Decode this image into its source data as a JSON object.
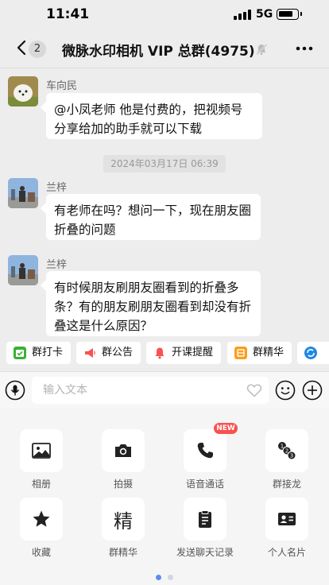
{
  "status_bar": {
    "time": "11:41",
    "network": "5G",
    "battery_level": 0.78
  },
  "nav": {
    "back_badge": "2",
    "title": "微脉水印相机 VIP 总群(4975)"
  },
  "messages": [
    {
      "sender": "车向民",
      "text": "@小凤老师  他是付费的，把视频号分享给加的助手就可以下载"
    },
    {
      "sender": "兰梓",
      "text": "有老师在吗？想问一下，现在朋友圈折叠的问题"
    },
    {
      "sender": "兰梓",
      "text": "有时候朋友刷朋友圈看到的折叠多条？有的朋友刷朋友圈看到却没有折叠这是什么原因？"
    }
  ],
  "timestamp": "2024年03月17日 06:39",
  "shortcuts": [
    {
      "label": "群打卡",
      "icon": "calendar-check-icon",
      "color": "#3cb035"
    },
    {
      "label": "群公告",
      "icon": "megaphone-icon",
      "color": "#fa5151"
    },
    {
      "label": "开课提醒",
      "icon": "bell-icon",
      "color": "#fa5151"
    },
    {
      "label": "群精华",
      "icon": "essence-icon",
      "color": "#ff9c19"
    },
    {
      "label": "",
      "icon": "sync-icon",
      "color": "#1e88e5"
    }
  ],
  "input": {
    "placeholder": "输入文本"
  },
  "tools": [
    {
      "label": "相册",
      "icon": "image-icon"
    },
    {
      "label": "拍摄",
      "icon": "camera-icon"
    },
    {
      "label": "语音通话",
      "icon": "phone-icon",
      "badge": "NEW"
    },
    {
      "label": "群接龙",
      "icon": "chain-numbers-icon"
    },
    {
      "label": "收藏",
      "icon": "star-icon"
    },
    {
      "label": "群精华",
      "icon": "essence-char-icon",
      "glyph": "精"
    },
    {
      "label": "发送聊天记录",
      "icon": "clipboard-icon"
    },
    {
      "label": "个人名片",
      "icon": "contact-card-icon"
    }
  ],
  "pager": {
    "pages": 2,
    "current": 1
  },
  "colors": {
    "background": "#ededed",
    "bubble": "#ffffff",
    "badge_red": "#fa5151",
    "pager_active": "#5b8def"
  }
}
